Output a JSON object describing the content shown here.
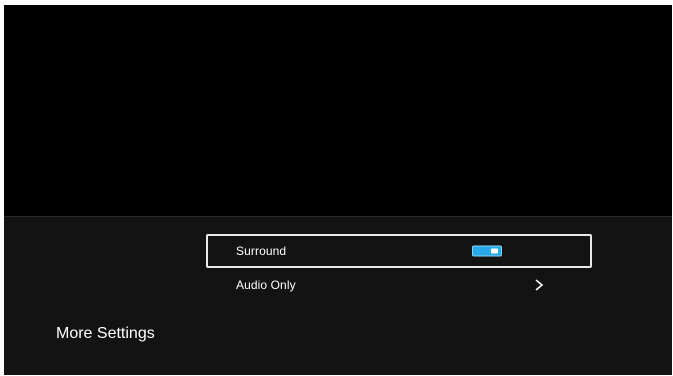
{
  "section": {
    "title": "More Settings"
  },
  "menu": {
    "items": [
      {
        "label": "Surround",
        "control": "toggle",
        "state": "on",
        "focused": true
      },
      {
        "label": "Audio Only",
        "control": "submenu",
        "icon": "chevron-right-icon",
        "focused": false
      }
    ]
  },
  "colors": {
    "screen_bg": "#000000",
    "panel_bg": "#131313",
    "focus_border": "#e9e9e9",
    "toggle_on": "#29a8e8",
    "text": "#ffffff"
  }
}
